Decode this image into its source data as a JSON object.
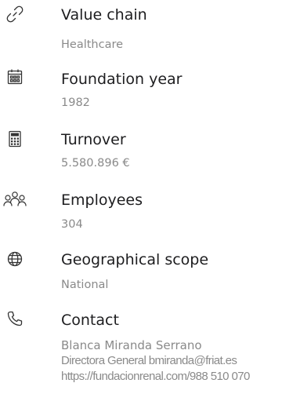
{
  "items": [
    {
      "label": "Value chain",
      "value": "Healthcare",
      "icon": "link-icon"
    },
    {
      "label": "Foundation year",
      "value": "1982",
      "icon": "calendar-icon"
    },
    {
      "label": "Turnover",
      "value": "5.580.896 €",
      "icon": "calculator-icon"
    },
    {
      "label": "Employees",
      "value": "304",
      "icon": "people-icon"
    },
    {
      "label": "Geographical scope",
      "value": "National",
      "icon": "globe-icon"
    }
  ],
  "contact": {
    "label": "Contact",
    "icon": "phone-icon",
    "name": "Blanca Miranda Serrano",
    "role_email": "Directora General bmiranda@friat.es",
    "url_phone": "https://fundacionrenal.com/988 510 070"
  },
  "colors": {
    "label": "#1d1d1f",
    "value": "#8a8a8a",
    "icon": "#333333"
  }
}
